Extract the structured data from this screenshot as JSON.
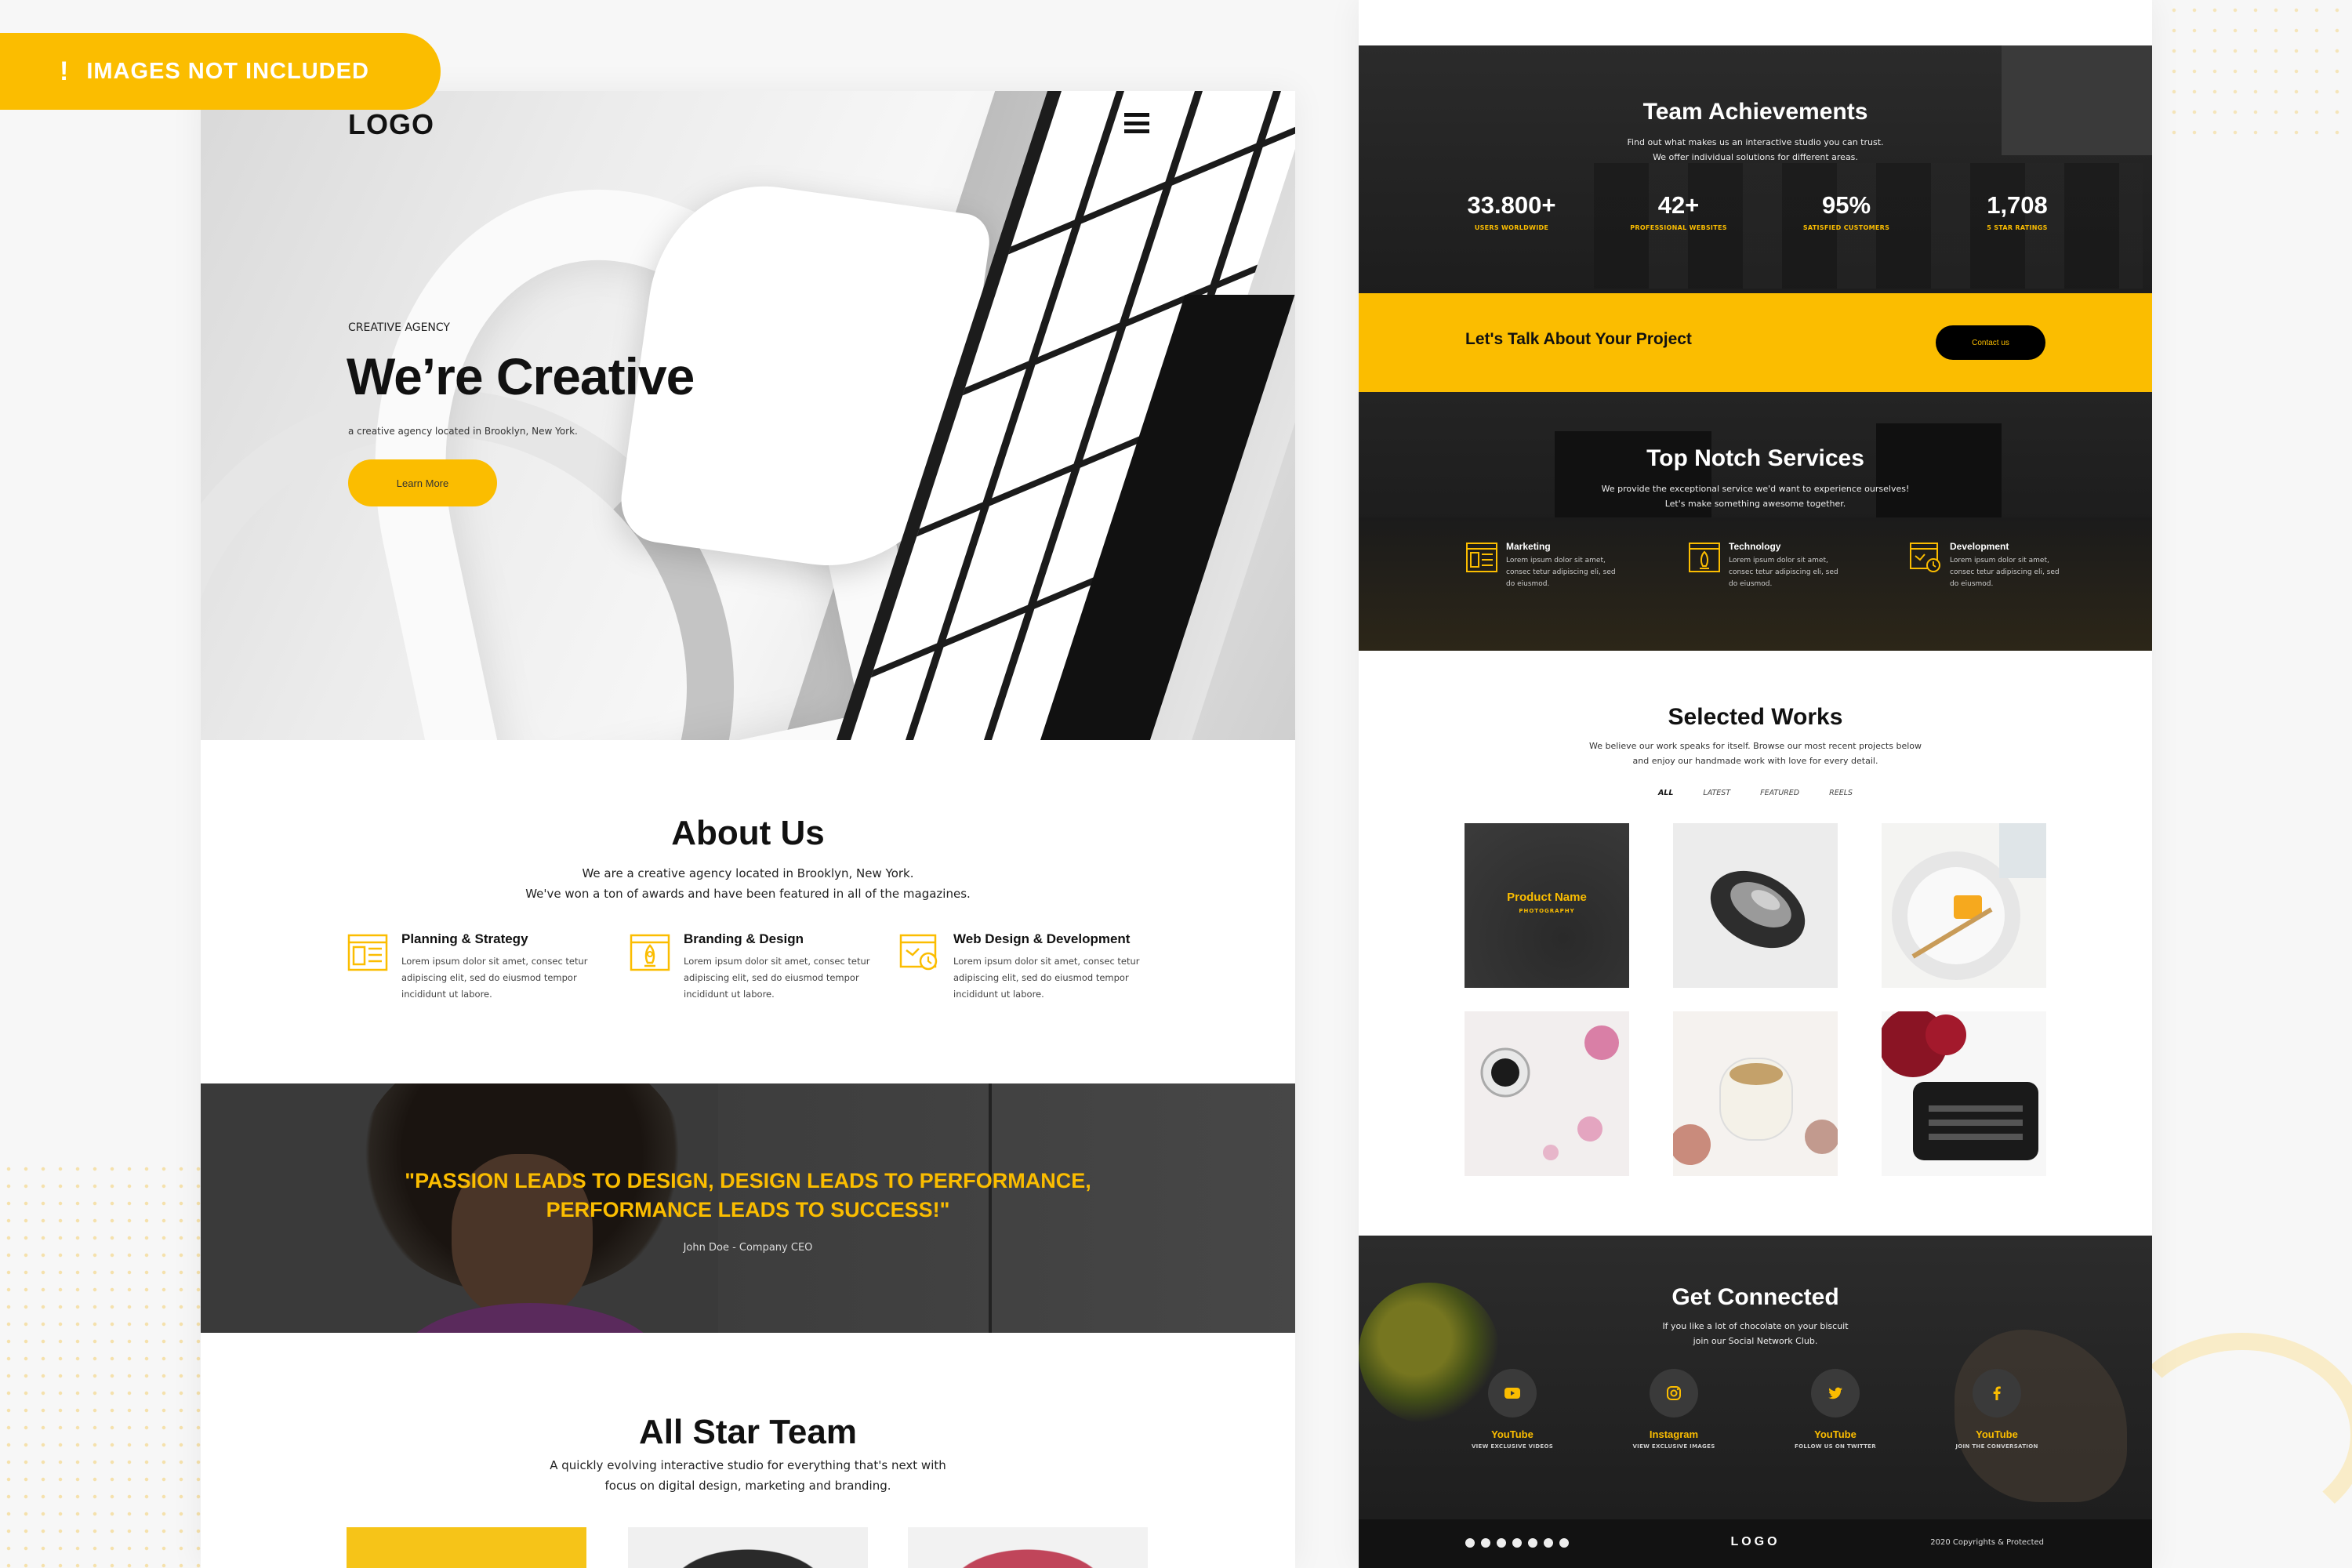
{
  "badge": {
    "text": "IMAGES NOT INCLUDED",
    "icon": "exclamation-icon"
  },
  "colors": {
    "accent": "#fbbd00",
    "dark": "#1d1d1d",
    "text": "#111111"
  },
  "hero": {
    "logo": "LOGO",
    "menu_icon": "hamburger-icon",
    "eyebrow": "CREATIVE AGENCY",
    "title": "We’re Creative",
    "subtitle": "a creative agency located in Brooklyn, New York.",
    "button": "Learn More"
  },
  "about": {
    "title": "About Us",
    "text_line1": "We are a creative agency located in Brooklyn, New York.",
    "text_line2": "We've won a ton of awards and have been featured in all of the magazines.",
    "features": [
      {
        "icon": "planning-icon",
        "title": "Planning & Strategy",
        "text": "Lorem ipsum dolor sit amet, consec tetur adipiscing elit, sed do eiusmod tempor incididunt ut labore."
      },
      {
        "icon": "rocket-icon",
        "title": "Branding & Design",
        "text": "Lorem ipsum dolor sit amet, consec tetur adipiscing elit, sed do eiusmod tempor incididunt ut labore."
      },
      {
        "icon": "web-design-icon",
        "title": "Web Design & Development",
        "text": "Lorem ipsum dolor sit amet, consec tetur adipiscing elit, sed do eiusmod tempor incididunt ut labore."
      }
    ]
  },
  "quote": {
    "line1": "\"PASSION LEADS TO DESIGN, DESIGN LEADS TO PERFORMANCE,",
    "line2": "PERFORMANCE LEADS TO SUCCESS!\"",
    "author": "John Doe - Company CEO"
  },
  "team": {
    "title": "All Star Team",
    "text_line1": "A quickly evolving interactive studio for everything that's next with",
    "text_line2": "focus on digital design, marketing and branding."
  },
  "achievements": {
    "title": "Team Achievements",
    "text_line1": "Find out what makes us an interactive studio you can trust.",
    "text_line2": "We offer individual solutions for different areas.",
    "stats": [
      {
        "value": "33.800+",
        "label": "USERS WORLDWIDE"
      },
      {
        "value": "42+",
        "label": "PROFESSIONAL WEBSITES"
      },
      {
        "value": "95%",
        "label": "SATISFIED CUSTOMERS"
      },
      {
        "value": "1,708",
        "label": "5 STAR RATINGS"
      }
    ]
  },
  "cta": {
    "text": "Let's Talk About Your Project",
    "button": "Contact us"
  },
  "services": {
    "title": "Top Notch Services",
    "text_line1": "We provide the exceptional service we'd want to experience ourselves!",
    "text_line2": "Let's make something awesome together.",
    "items": [
      {
        "icon": "marketing-icon",
        "title": "Marketing",
        "text": "Lorem ipsum dolor sit amet, consec tetur adipiscing eli, sed do eiusmod."
      },
      {
        "icon": "technology-icon",
        "title": "Technology",
        "text": "Lorem ipsum dolor sit amet, consec tetur adipiscing eli, sed do eiusmod."
      },
      {
        "icon": "development-icon",
        "title": "Development",
        "text": "Lorem ipsum dolor sit amet, consec tetur adipiscing eli, sed do eiusmod."
      }
    ]
  },
  "works": {
    "title": "Selected Works",
    "text_line1": "We believe our work speaks for itself. Browse our most recent projects below",
    "text_line2": "and enjoy our handmade work with love for every detail.",
    "filters": [
      "ALL",
      "LATEST",
      "FEATURED",
      "REELS"
    ],
    "hover_title": "Product Name",
    "hover_category": "PHOTOGRAPHY"
  },
  "connected": {
    "title": "Get Connected",
    "text_line1": "If you like a lot of chocolate on your biscuit",
    "text_line2": "join our Social Network Club.",
    "socials": [
      {
        "icon": "youtube-icon",
        "name": "YouTube",
        "sub": "VIEW EXCLUSIVE VIDEOS"
      },
      {
        "icon": "instagram-icon",
        "name": "Instagram",
        "sub": "VIEW EXCLUSIVE IMAGES"
      },
      {
        "icon": "twitter-icon",
        "name": "YouTube",
        "sub": "FOLLOW US ON TWITTER"
      },
      {
        "icon": "facebook-icon",
        "name": "YouTube",
        "sub": "JOIN THE CONVERSATION"
      }
    ]
  },
  "footer": {
    "logo": "LOGO",
    "copyright": "2020 Copyrights & Protected"
  }
}
